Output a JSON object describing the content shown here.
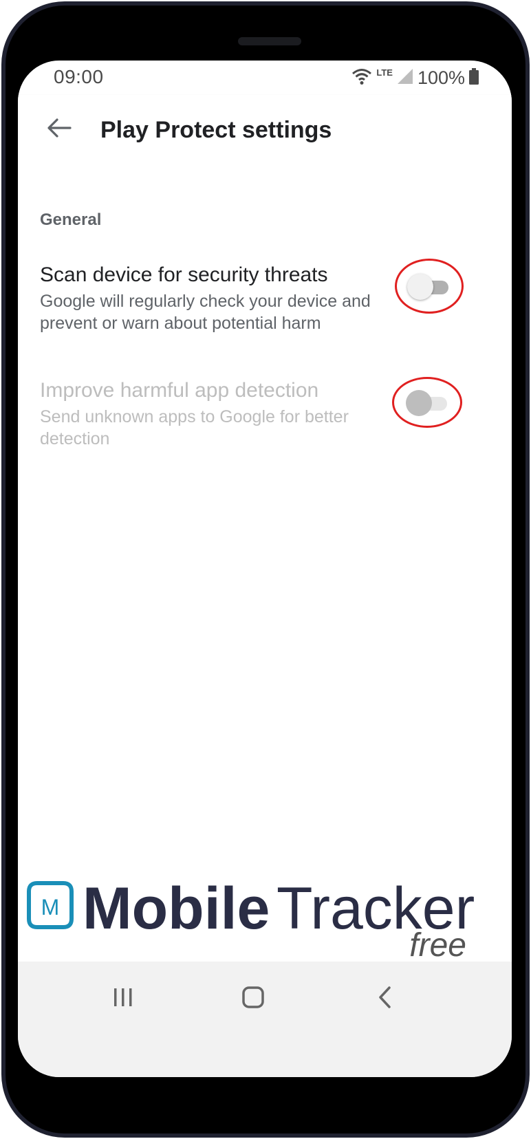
{
  "status_bar": {
    "time": "09:00",
    "network": "LTE",
    "battery": "100%"
  },
  "app_bar": {
    "title": "Play Protect settings"
  },
  "section": {
    "header": "General"
  },
  "preferences": [
    {
      "title": "Scan device for security threats",
      "summary": "Google will regularly check your device and prevent or warn about potential harm",
      "enabled": true,
      "checked": false
    },
    {
      "title": "Improve harmful app detection",
      "summary": "Send unknown apps to Google for better detection",
      "enabled": false,
      "checked": false
    }
  ],
  "watermark": {
    "logo_letter": "M",
    "brand_bold": "Mobile",
    "brand_light": "Tracker",
    "tagline": "free"
  },
  "colors": {
    "highlight_ring": "#e02020",
    "brand_teal": "#1a8fb8",
    "brand_dark": "#2a2d45"
  }
}
